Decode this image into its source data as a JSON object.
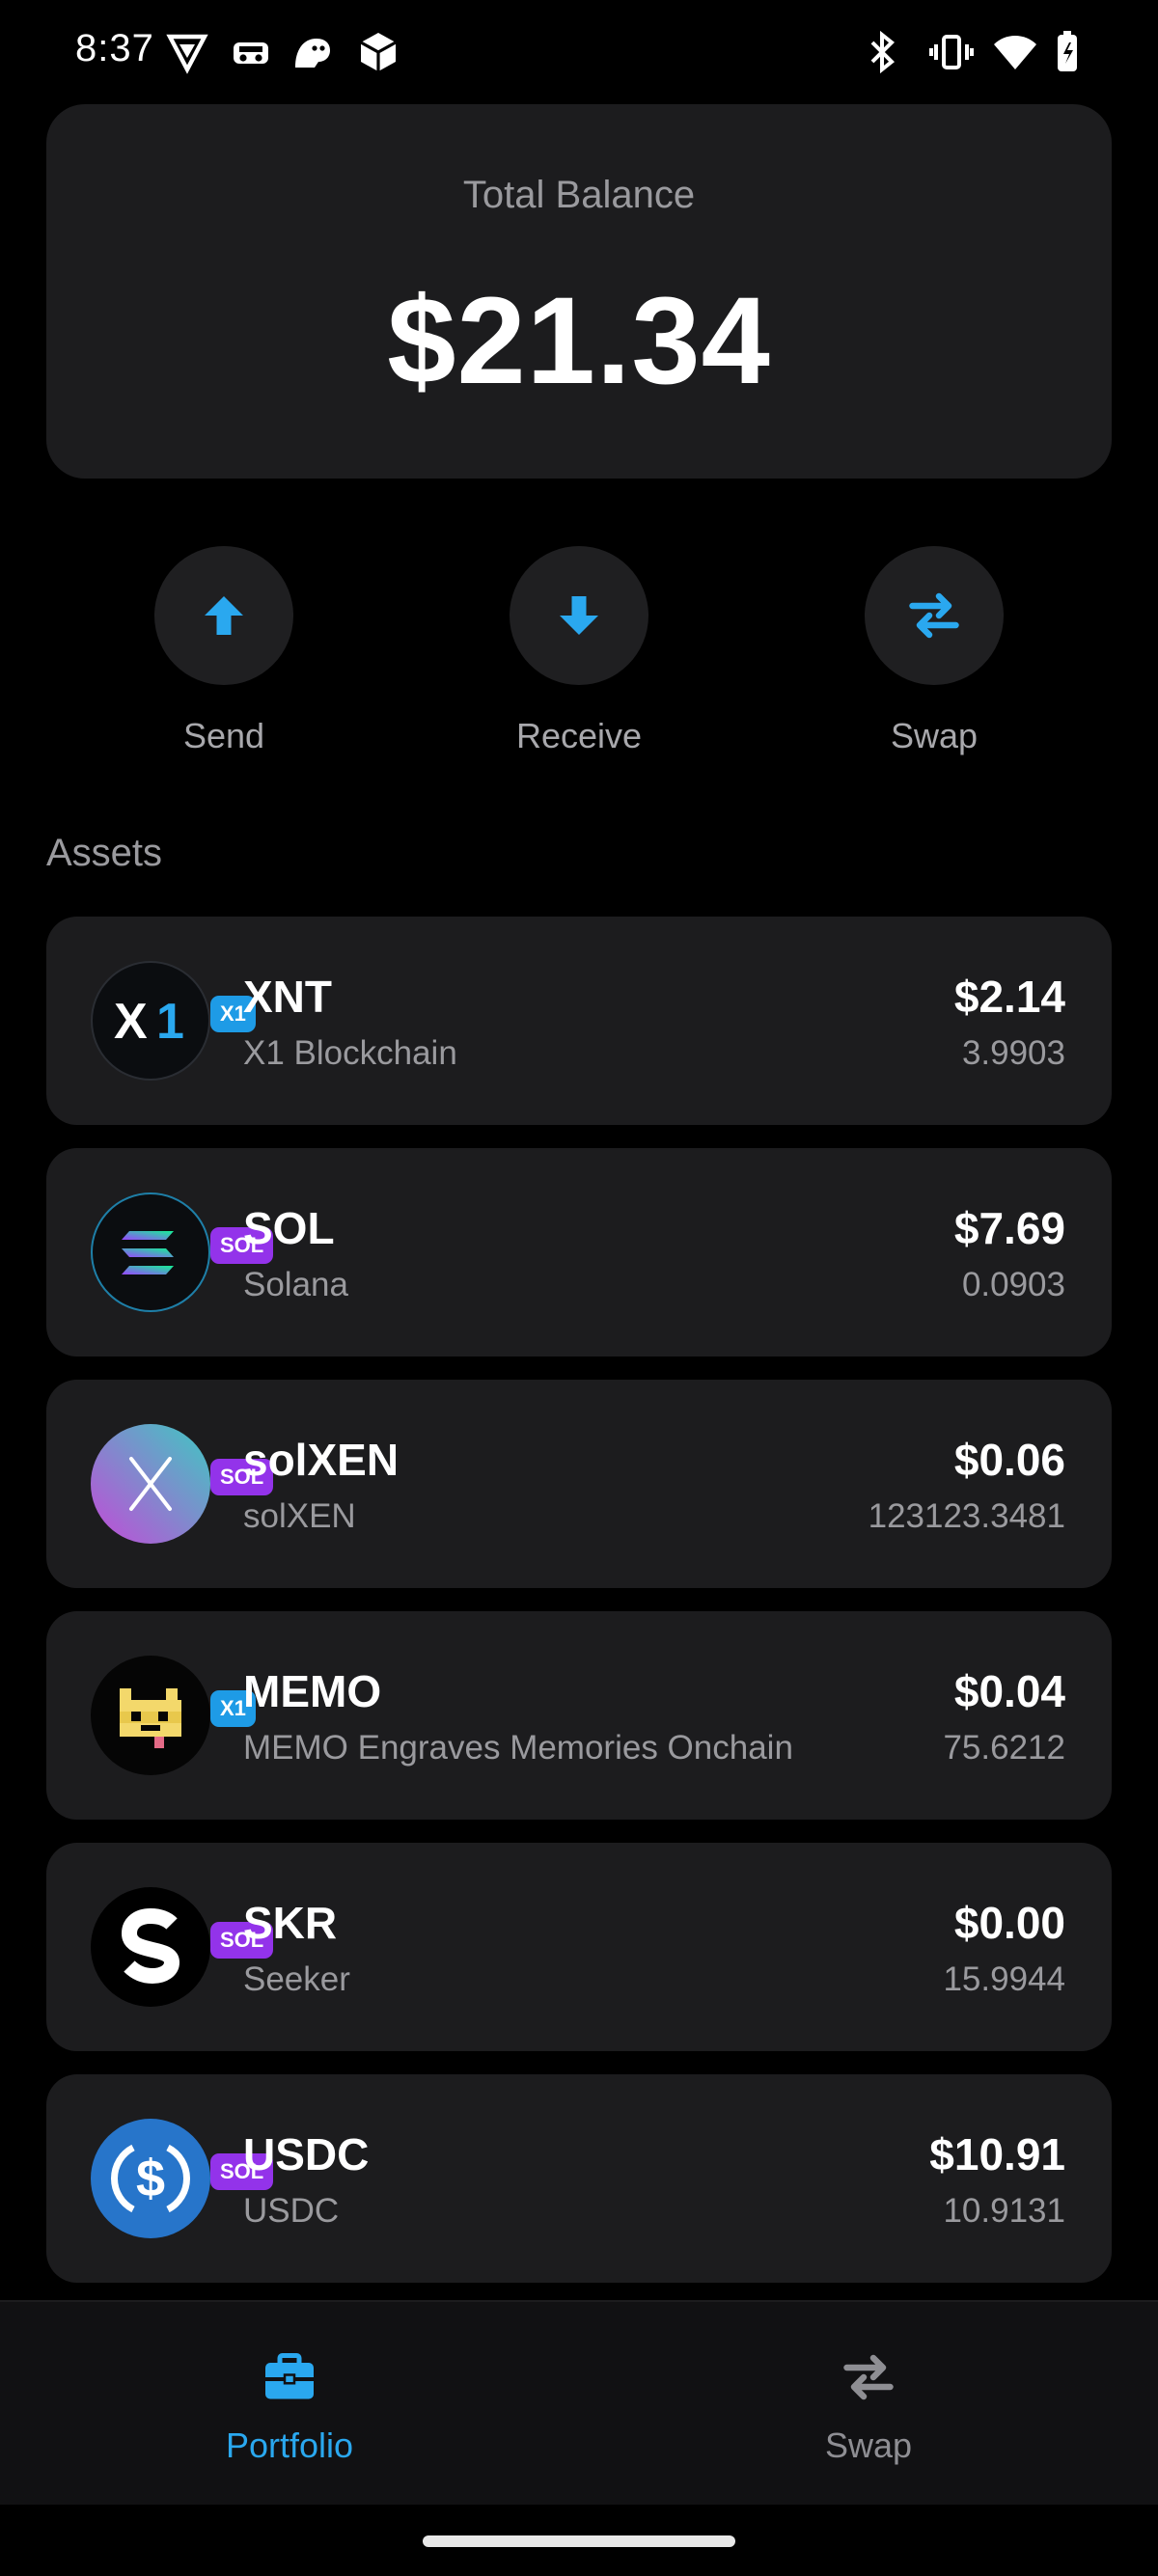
{
  "status_bar": {
    "time": "8:37"
  },
  "balance": {
    "label": "Total Balance",
    "value": "$21.34"
  },
  "actions": [
    {
      "label": "Send",
      "icon": "arrow-up-icon"
    },
    {
      "label": "Receive",
      "icon": "arrow-down-icon"
    },
    {
      "label": "Swap",
      "icon": "swap-arrows-icon"
    }
  ],
  "assets_title": "Assets",
  "assets": [
    {
      "symbol": "XNT",
      "name": "X1 Blockchain",
      "usd": "$2.14",
      "amount": "3.9903",
      "chain": "X1"
    },
    {
      "symbol": "SOL",
      "name": "Solana",
      "usd": "$7.69",
      "amount": "0.0903",
      "chain": "SOL"
    },
    {
      "symbol": "solXEN",
      "name": "solXEN",
      "usd": "$0.06",
      "amount": "123123.3481",
      "chain": "SOL"
    },
    {
      "symbol": "MEMO",
      "name": "MEMO Engraves Memories Onchain",
      "usd": "$0.04",
      "amount": "75.6212",
      "chain": "X1"
    },
    {
      "symbol": "SKR",
      "name": "Seeker",
      "usd": "$0.00",
      "amount": "15.9944",
      "chain": "SOL"
    },
    {
      "symbol": "USDC",
      "name": "USDC",
      "usd": "$10.91",
      "amount": "10.9131",
      "chain": "SOL"
    }
  ],
  "bottom_nav": {
    "portfolio_label": "Portfolio",
    "swap_label": "Swap",
    "active": "Portfolio"
  },
  "colors": {
    "accent": "#2aa8ef",
    "card": "#1c1c1e",
    "muted_text": "#9a9a9e",
    "badge_x1": "#1e9be6",
    "badge_sol": "#9333ea"
  }
}
